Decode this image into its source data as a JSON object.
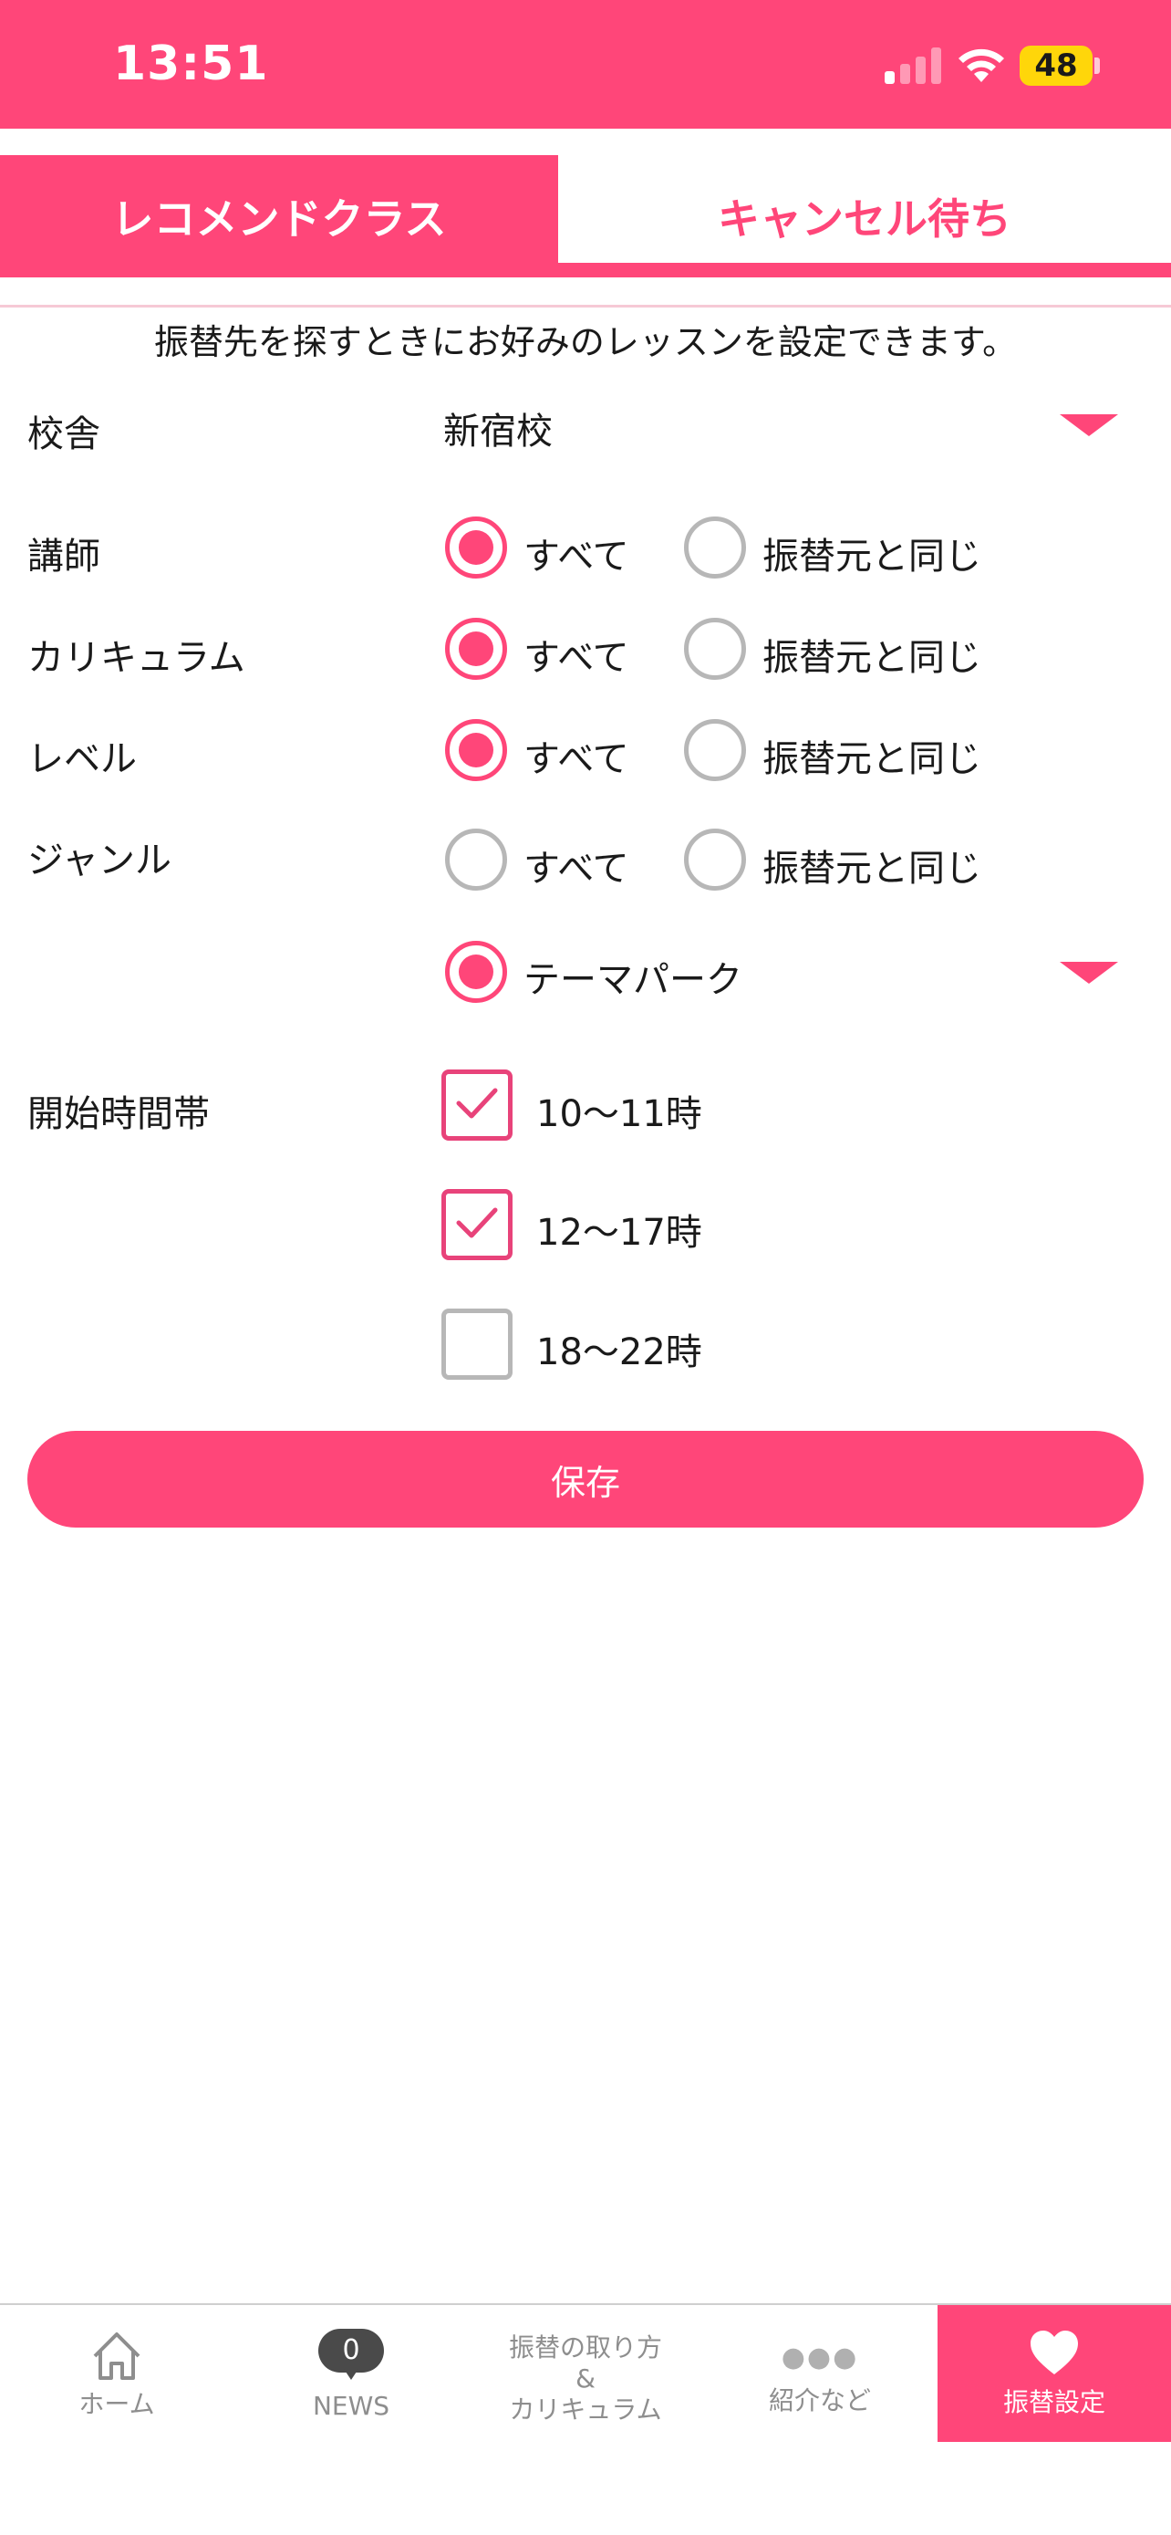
{
  "status_bar": {
    "time": "13:51",
    "battery": "48"
  },
  "tabs": {
    "recommend": "レコメンドクラス",
    "cancel_wait": "キャンセル待ち"
  },
  "intro": "振替先を探すときにお好みのレッスンを設定できます。",
  "form": {
    "campus": {
      "label": "校舎",
      "value": "新宿校"
    },
    "teacher": {
      "label": "講師",
      "opt_all": "すべて",
      "opt_same": "振替元と同じ",
      "selected": "all"
    },
    "curriculum": {
      "label": "カリキュラム",
      "opt_all": "すべて",
      "opt_same": "振替元と同じ",
      "selected": "all"
    },
    "level": {
      "label": "レベル",
      "opt_all": "すべて",
      "opt_same": "振替元と同じ",
      "selected": "all"
    },
    "genre": {
      "label": "ジャンル",
      "opt_all": "すべて",
      "opt_same": "振替元と同じ",
      "opt_custom": "テーマパーク",
      "selected": "custom"
    },
    "start_time": {
      "label": "開始時間帯",
      "options": [
        {
          "label": "10～11時",
          "checked": true
        },
        {
          "label": "12～17時",
          "checked": true
        },
        {
          "label": "18～22時",
          "checked": false
        }
      ]
    },
    "save_label": "保存"
  },
  "bottom_nav": {
    "home": "ホーム",
    "news": "NEWS",
    "news_count": "0",
    "howto_line1": "振替の取り方",
    "howto_line2": "&",
    "howto_line3": "カリキュラム",
    "intro": "紹介など",
    "settings": "振替設定"
  },
  "colors": {
    "accent": "#ff4679",
    "text": "#1a1a1a",
    "inactive": "#b7b7b7"
  }
}
